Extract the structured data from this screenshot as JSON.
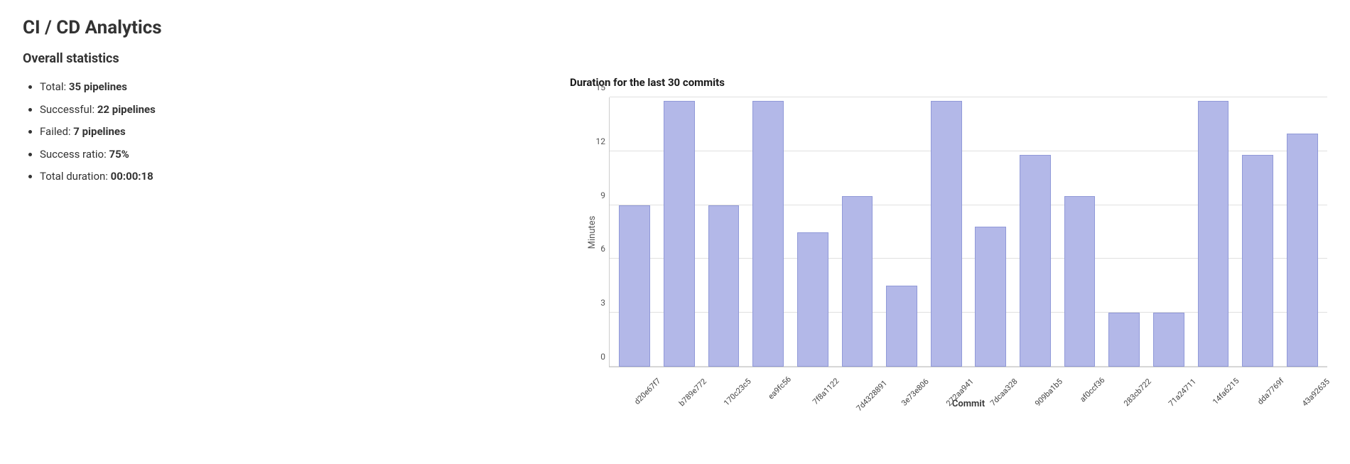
{
  "page": {
    "title": "CI / CD Analytics",
    "stats_heading": "Overall statistics"
  },
  "stats": {
    "total_label": "Total:",
    "total_value": "35 pipelines",
    "successful_label": "Successful:",
    "successful_value": "22 pipelines",
    "failed_label": "Failed:",
    "failed_value": "7 pipelines",
    "ratio_label": "Success ratio:",
    "ratio_value": "75%",
    "duration_label": "Total duration:",
    "duration_value": "00:00:18"
  },
  "chart": {
    "title": "Duration for the last 30 commits",
    "y_label": "Minutes",
    "x_label": "Commit",
    "y_max": 15,
    "y_ticks": [
      0,
      3,
      6,
      9,
      12,
      15
    ],
    "bars": [
      {
        "commit": "d20e67f7",
        "value": 9
      },
      {
        "commit": "b789e772",
        "value": 14.8
      },
      {
        "commit": "170c23c5",
        "value": 9
      },
      {
        "commit": "ea9fc56",
        "value": 14.8
      },
      {
        "commit": "7f8a1122",
        "value": 7.5
      },
      {
        "commit": "7d4328891",
        "value": 9.5
      },
      {
        "commit": "3e73e806",
        "value": 4.5
      },
      {
        "commit": "272aa941",
        "value": 14.8
      },
      {
        "commit": "7dcaa328",
        "value": 7.8
      },
      {
        "commit": "909ba1b5",
        "value": 11.8
      },
      {
        "commit": "af0ccf36",
        "value": 9.5
      },
      {
        "commit": "283cb722",
        "value": 3
      },
      {
        "commit": "71a24711",
        "value": 3
      },
      {
        "commit": "14fa6215",
        "value": 14.8
      },
      {
        "commit": "dda7769f",
        "value": 11.8
      },
      {
        "commit": "43a92635",
        "value": 13
      }
    ]
  }
}
